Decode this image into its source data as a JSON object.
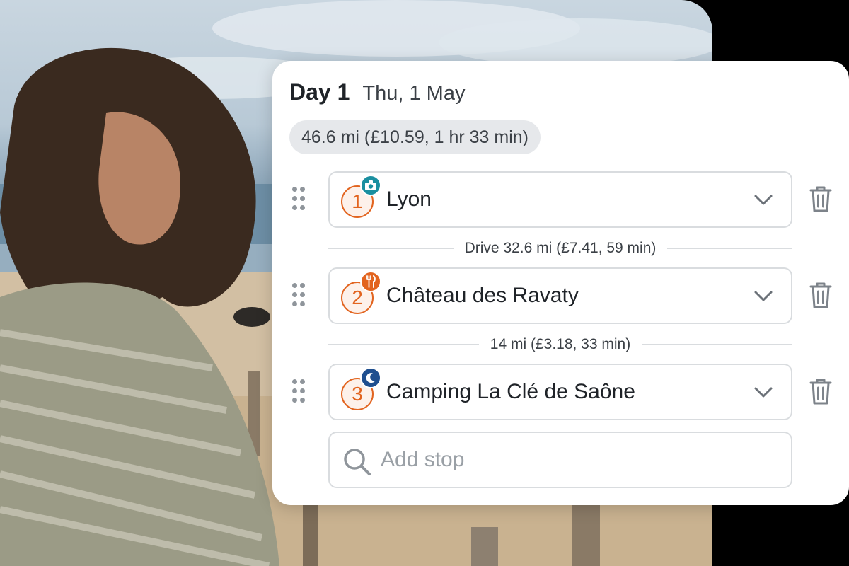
{
  "day": {
    "title": "Day 1",
    "date": "Thu, 1 May",
    "summary": "46.6 mi (£10.59, 1 hr 33 min)"
  },
  "stops": [
    {
      "number": "1",
      "name": "Lyon",
      "category_icon": "camera-icon",
      "category_color": "#1a8fa0"
    },
    {
      "number": "2",
      "name": "Château des Ravaty",
      "category_icon": "fork-knife-icon",
      "category_color": "#e2641f"
    },
    {
      "number": "3",
      "name": "Camping La Clé de Saône",
      "category_icon": "moon-icon",
      "category_color": "#1f4f8f"
    }
  ],
  "legs": [
    {
      "text": "Drive 32.6 mi (£7.41, 59 min)"
    },
    {
      "text": "14 mi (£3.18, 33 min)"
    }
  ],
  "add_stop": {
    "placeholder": "Add stop"
  },
  "colors": {
    "accent": "#e2641f",
    "border": "#d9dcdf",
    "text": "#1f2328"
  }
}
